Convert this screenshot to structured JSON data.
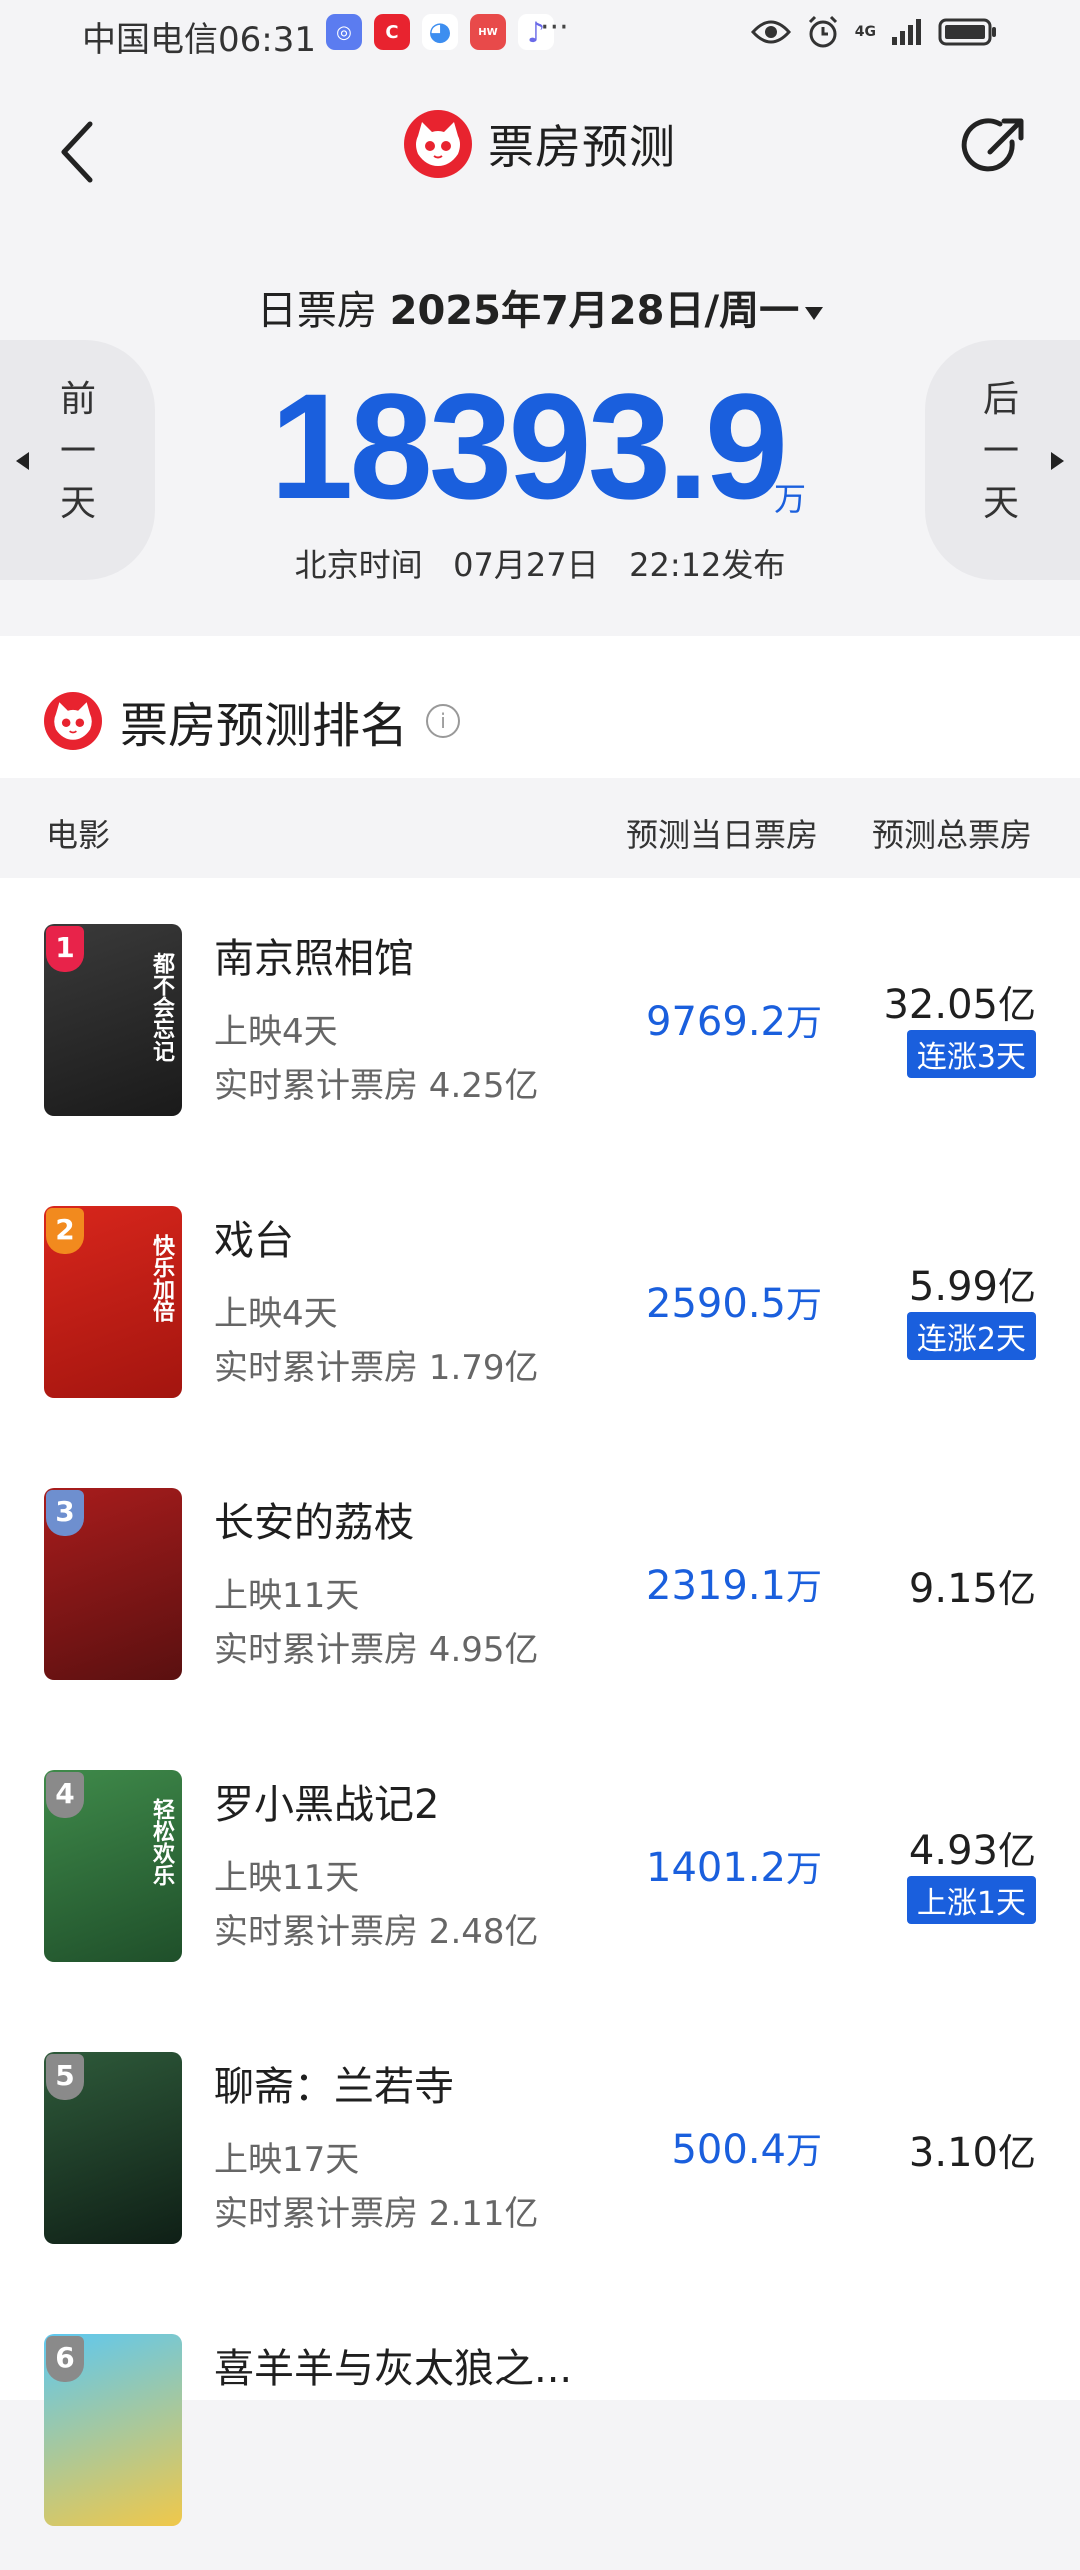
{
  "status_bar": {
    "carrier_time": "中国电信06:31",
    "dots": "···",
    "network": "4G",
    "app_icon_colors": [
      "#5b7cf0",
      "#e8232f",
      "#3d8ef0",
      "#e84a4a",
      "#6a6ae8"
    ]
  },
  "header": {
    "title": "票房预测",
    "back_icon": "chevron-left-icon",
    "share_icon": "share-icon"
  },
  "daily": {
    "label": "日票房",
    "date": "2025年7月28日/周一",
    "amount": "18393.9",
    "unit": "万",
    "prev_day": [
      "前",
      "一",
      "天"
    ],
    "next_day": [
      "后",
      "一",
      "天"
    ],
    "publish": "北京时间   07月27日   22:12发布"
  },
  "ranking": {
    "title": "票房预测排名",
    "columns": {
      "movie": "电影",
      "daily": "预测当日票房",
      "total": "预测总票房"
    },
    "movies": [
      {
        "rank": "1",
        "name": "南京照相馆",
        "days": "上映4天",
        "cumulative": "实时累计票房 4.25亿",
        "daily": "9769.2",
        "daily_unit": "万",
        "total": "32.05",
        "total_unit": "亿",
        "trend": "连涨3天",
        "badge_color": "#e8234a",
        "poster_colors": [
          "#3a3a3a",
          "#1a1a1a"
        ],
        "poster_text": "都不会忘记"
      },
      {
        "rank": "2",
        "name": "戏台",
        "days": "上映4天",
        "cumulative": "实时累计票房 1.79亿",
        "daily": "2590.5",
        "daily_unit": "万",
        "total": "5.99",
        "total_unit": "亿",
        "trend": "连涨2天",
        "badge_color": "#f28a1e",
        "poster_colors": [
          "#d8261c",
          "#a3150f"
        ],
        "poster_text": "快乐加倍"
      },
      {
        "rank": "3",
        "name": "长安的荔枝",
        "days": "上映11天",
        "cumulative": "实时累计票房 4.95亿",
        "daily": "2319.1",
        "daily_unit": "万",
        "total": "9.15",
        "total_unit": "亿",
        "trend": "",
        "badge_color": "#6e8fcf",
        "poster_colors": [
          "#a81c1c",
          "#5a1010"
        ],
        "poster_text": ""
      },
      {
        "rank": "4",
        "name": "罗小黑战记2",
        "days": "上映11天",
        "cumulative": "实时累计票房 2.48亿",
        "daily": "1401.2",
        "daily_unit": "万",
        "total": "4.93",
        "total_unit": "亿",
        "trend": "上涨1天",
        "badge_color": "#8a8a8a",
        "poster_colors": [
          "#3f8a4a",
          "#1f4f2a"
        ],
        "poster_text": "轻松欢乐"
      },
      {
        "rank": "5",
        "name": "聊斋：兰若寺",
        "days": "上映17天",
        "cumulative": "实时累计票房 2.11亿",
        "daily": "500.4",
        "daily_unit": "万",
        "total": "3.10",
        "total_unit": "亿",
        "trend": "",
        "badge_color": "#8a8a8a",
        "poster_colors": [
          "#2e5a3a",
          "#0f1f16"
        ],
        "poster_text": ""
      },
      {
        "rank": "6",
        "name": "喜羊羊与灰太狼之...",
        "days": "",
        "cumulative": "",
        "daily": "",
        "daily_unit": "",
        "total": "",
        "total_unit": "",
        "trend": "",
        "badge_color": "#8a8a8a",
        "poster_colors": [
          "#5ec8f0",
          "#f0c84a"
        ],
        "poster_text": ""
      }
    ]
  }
}
